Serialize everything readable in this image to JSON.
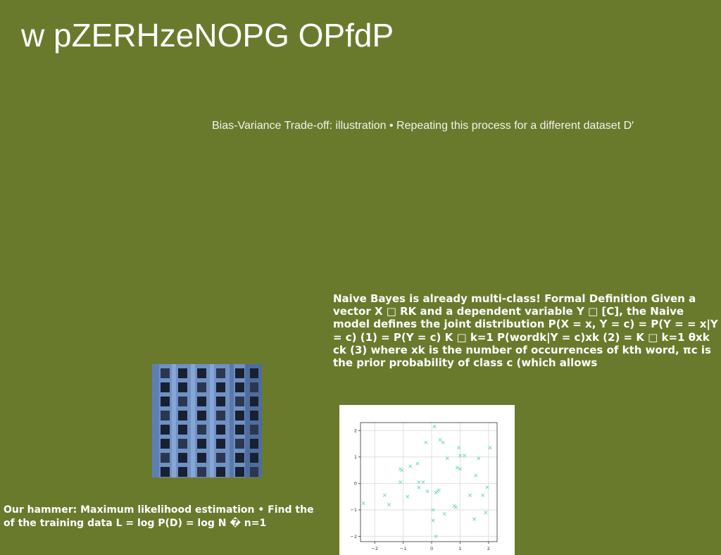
{
  "slide": {
    "title": "w pZERHzeNOPG OPfdP",
    "subtitle": "Bias-Variance Trade-off: illustration • Repeating this process for a different dataset D′",
    "naive_bayes_text": "Naive Bayes is already multi-class! Formal Definition Given a vector X □ RK and a dependent variable Y □ [C], the Naive model defines the joint distribution P(X = x, Y = c) = P(Y = = x|Y = c) (1) = P(Y = c) K □ k=1 P(wordk|Y = c)xk (2) = K □ k=1 θxk ck (3) where xk is the number of occurrences of kth word, πc is the prior probability of class c (which allows",
    "hammer_line1": "Our hammer: Maximum likelihood estimation • Find the",
    "hammer_line2": "of the training data L = log P(D) = log N � n=1"
  },
  "colors": {
    "background": "#6a7a2d",
    "text": "#ffffff",
    "marker": "#6fd3c0"
  },
  "chart_data": {
    "type": "scatter",
    "title": "",
    "xlabel": "",
    "ylabel": "",
    "xlim": [
      -2.5,
      2.3
    ],
    "ylim": [
      -2.2,
      2.3
    ],
    "x_ticks": [
      -2,
      -1,
      0,
      1,
      2
    ],
    "y_ticks": [
      -2,
      -1,
      0,
      1,
      2
    ],
    "grid": true,
    "marker": "x",
    "series": [
      {
        "points": [
          [
            -2.4,
            -0.75
          ],
          [
            -1.65,
            -0.45
          ],
          [
            -1.5,
            -0.8
          ],
          [
            -1.1,
            0.55
          ],
          [
            -1.05,
            0.5
          ],
          [
            -1.1,
            0.05
          ],
          [
            -0.85,
            -0.5
          ],
          [
            -0.75,
            0.65
          ],
          [
            -0.5,
            0.75
          ],
          [
            -0.45,
            0.05
          ],
          [
            -0.45,
            -0.15
          ],
          [
            -0.3,
            0.05
          ],
          [
            -0.2,
            1.55
          ],
          [
            -0.15,
            -0.3
          ],
          [
            0.05,
            -1.0
          ],
          [
            0.05,
            -1.4
          ],
          [
            0.1,
            2.15
          ],
          [
            0.15,
            -0.35
          ],
          [
            0.2,
            -0.3
          ],
          [
            0.15,
            -2.0
          ],
          [
            0.25,
            -0.25
          ],
          [
            0.3,
            1.65
          ],
          [
            0.4,
            1.55
          ],
          [
            0.45,
            -1.15
          ],
          [
            0.55,
            0.95
          ],
          [
            0.8,
            -0.85
          ],
          [
            0.85,
            -0.9
          ],
          [
            0.9,
            0.6
          ],
          [
            0.95,
            1.35
          ],
          [
            1.0,
            1.05
          ],
          [
            1.0,
            0.55
          ],
          [
            1.15,
            1.05
          ],
          [
            1.35,
            -0.45
          ],
          [
            1.5,
            -1.35
          ],
          [
            1.55,
            0.3
          ],
          [
            1.65,
            0.95
          ],
          [
            1.8,
            -0.45
          ],
          [
            1.95,
            -0.15
          ],
          [
            1.9,
            -1.1
          ],
          [
            2.05,
            1.35
          ]
        ]
      }
    ]
  }
}
